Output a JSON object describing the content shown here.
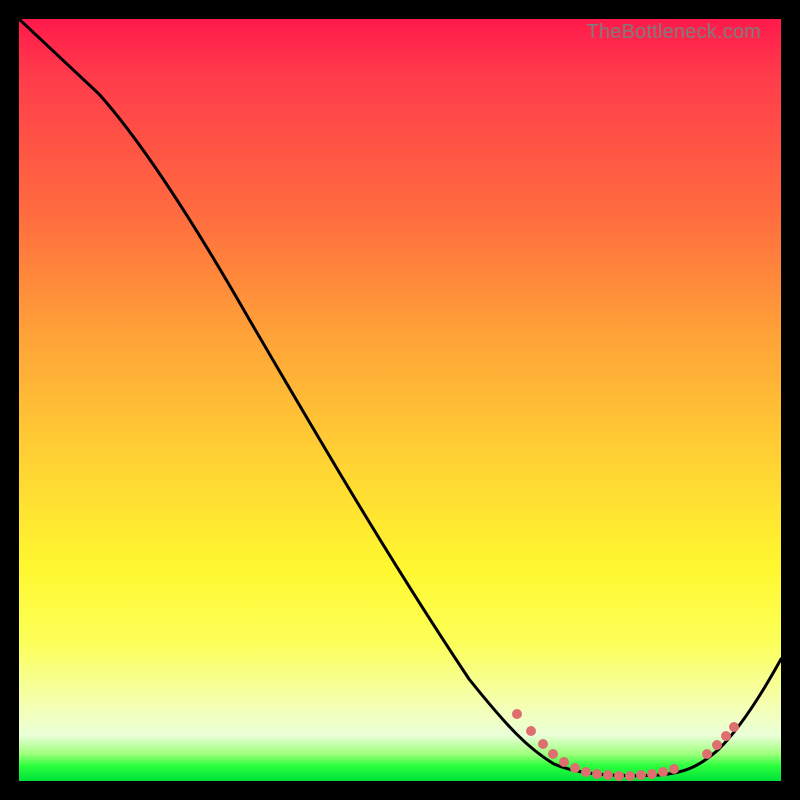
{
  "watermark": "TheBottleneck.com",
  "chart_data": {
    "type": "line",
    "title": "",
    "xlabel": "",
    "ylabel": "",
    "xlim": [
      0,
      100
    ],
    "ylim": [
      0,
      100
    ],
    "series": [
      {
        "name": "bottleneck-curve",
        "x": [
          0,
          10,
          20,
          30,
          40,
          50,
          60,
          68,
          72,
          76,
          80,
          84,
          88,
          92,
          100
        ],
        "y": [
          100,
          90,
          76,
          62,
          48,
          35,
          22,
          10,
          4,
          1,
          0,
          0,
          1,
          4,
          18
        ],
        "stroke": "#000000"
      }
    ],
    "markers": {
      "name": "valley-dots",
      "color": "#e06666",
      "x": [
        65,
        68,
        70,
        72,
        74,
        75,
        76,
        77,
        78,
        79,
        80,
        81,
        82,
        83,
        84,
        85,
        86,
        90,
        91,
        92,
        93
      ],
      "y": [
        13,
        9,
        6,
        4,
        2.5,
        2,
        1.5,
        1.2,
        1,
        0.8,
        0.6,
        0.5,
        0.5,
        0.6,
        0.8,
        1.1,
        1.6,
        3.2,
        3.8,
        4.5,
        5.4
      ]
    }
  }
}
